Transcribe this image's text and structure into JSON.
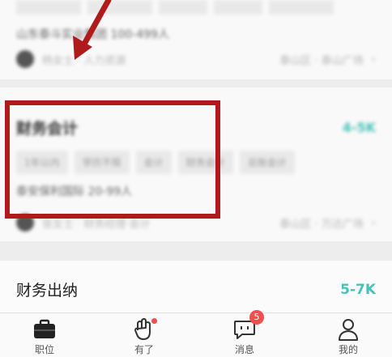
{
  "job1": {
    "company_info": "山东泰斗实业集团 100-499人",
    "recruiter": "杨女士 · 人力资源",
    "location": "泰山区 · 泰山广场"
  },
  "job2": {
    "title": "财务会计",
    "salary": "4-5K",
    "tags": [
      "1年以内",
      "学历不限",
      "会计",
      "财务会计",
      "总账会计"
    ],
    "company_info": "泰安保利国际 20-99人",
    "recruiter": "张女士 · 财务经理·会计",
    "location": "泰山区 · 万达广场"
  },
  "job3": {
    "title": "财务出纳",
    "salary": "5-7K"
  },
  "tabbar": {
    "tabs": [
      {
        "label": "职位",
        "icon": "briefcase-icon"
      },
      {
        "label": "有了",
        "icon": "hand-icon"
      },
      {
        "label": "消息",
        "icon": "chat-icon",
        "badge": "5"
      },
      {
        "label": "我的",
        "icon": "profile-icon"
      }
    ]
  },
  "colors": {
    "accent": "#45c3b7",
    "annotation_red": "#b11a1a",
    "notification_red": "#ef4f4f"
  }
}
